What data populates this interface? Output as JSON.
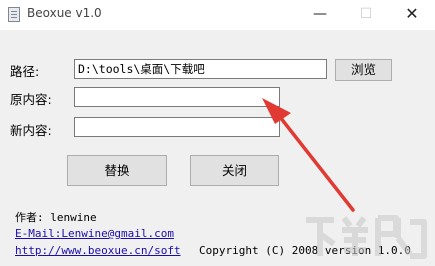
{
  "window": {
    "title": "Beoxue v1.0",
    "icon": "app-icon",
    "controls": {
      "minimize": "—",
      "maximize": "☐",
      "close": "✕"
    }
  },
  "form": {
    "path_label": "路径:",
    "path_value": "D:\\tools\\桌面\\下载吧",
    "browse_label": "浏览",
    "original_label": "原内容:",
    "original_value": "",
    "new_label": "新内容:",
    "new_value": ""
  },
  "buttons": {
    "replace_label": "替换",
    "close_label": "关闭"
  },
  "footer": {
    "author": "作者: lenwine",
    "email": "E-Mail:Lenwine@gmail.com",
    "website": "http://www.beoxue.cn/soft",
    "copyright": "Copyright (C) 2008 version 1.0.0"
  },
  "annotation": {
    "arrow_color": "#e03a32"
  }
}
